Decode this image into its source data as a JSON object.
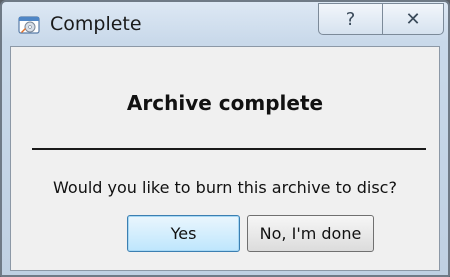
{
  "window": {
    "title": "Complete",
    "app_icon": "disc-burn-icon",
    "help_glyph": "?",
    "close_glyph": "✕"
  },
  "content": {
    "heading": "Archive complete",
    "question": "Would you like to burn this archive to disc?"
  },
  "buttons": {
    "yes_label": "Yes",
    "no_label": "No, I'm done"
  },
  "colors": {
    "default_button_border": "#3c7fb1",
    "default_button_fill": "#bee6fd",
    "client_background": "#f0f0f0"
  }
}
